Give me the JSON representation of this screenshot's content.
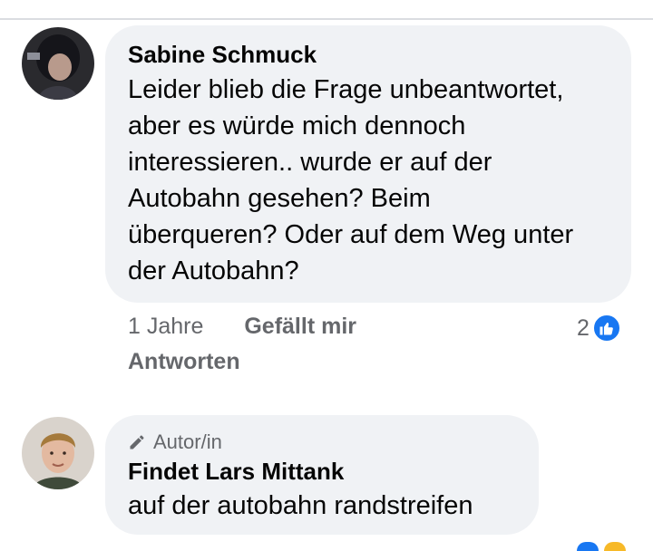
{
  "comments": [
    {
      "author": "Sabine Schmuck",
      "text": "Leider blieb die Frage unbeantwortet, aber es würde mich dennoch interessieren.. wurde er auf der Autobahn gesehen? Beim überqueren? Oder auf dem Weg unter der Autobahn?",
      "lines": [
        "Leider blieb die Frage unbeantwortet,",
        "aber es würde mich dennoch",
        "interessieren.. wurde er auf der",
        "Autobahn gesehen? Beim",
        "überqueren? Oder auf dem Weg unter",
        "der Autobahn?"
      ],
      "time": "1 Jahre",
      "like_label": "Gefällt mir",
      "reply_label": "Antworten",
      "reaction_count": "2",
      "reaction_icon": "thumbs-up-icon"
    },
    {
      "author_badge": "Autor/in",
      "author_badge_icon": "pencil-icon",
      "author": "Findet Lars Mittank",
      "text": "auf der autobahn randstreifen"
    }
  ],
  "colors": {
    "bubble": "#f0f2f5",
    "meta_text": "#65676b",
    "like_blue": "#1877f2",
    "divider": "#dadde1"
  }
}
